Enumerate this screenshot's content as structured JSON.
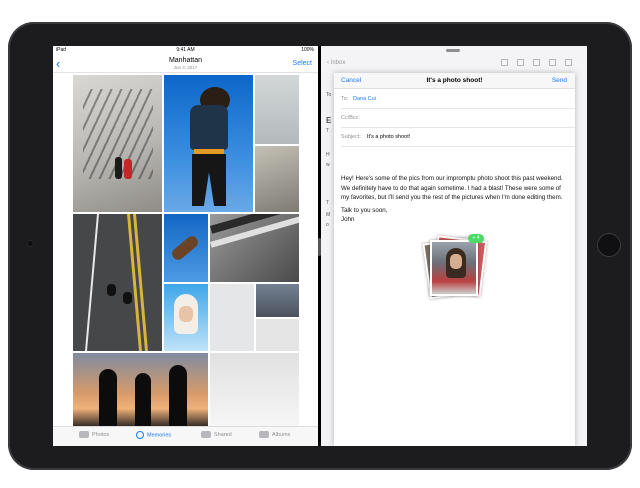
{
  "photos": {
    "status": {
      "left": "iPad",
      "time": "9:41 AM",
      "battery": "100%"
    },
    "nav": {
      "title": "Manhattan",
      "subtitle": "Jun 3, 2017",
      "select": "Select"
    },
    "tabs": [
      {
        "label": "Photos",
        "icon": "photos-icon",
        "active": false
      },
      {
        "label": "Memories",
        "icon": "memories-icon",
        "active": true
      },
      {
        "label": "Shared",
        "icon": "cloud-icon",
        "active": false
      },
      {
        "label": "Albums",
        "icon": "albums-icon",
        "active": false
      }
    ]
  },
  "mail": {
    "toolbar": {
      "inbox": "Inbox"
    },
    "side_letters": [
      "To",
      "E",
      "T",
      "H",
      "w",
      "T",
      "M",
      "o"
    ]
  },
  "compose": {
    "cancel": "Cancel",
    "title": "It's a photo shoot!",
    "send": "Send",
    "to_label": "To:",
    "to_value": "Dana Cui",
    "cc_label": "Cc/Bcc:",
    "subject_label": "Subject:",
    "subject_value": "It's a photo shoot!",
    "body": [
      "Hey! Here's some of the pics from our impromptu photo shoot this past weekend. We definitely have to do that again sometime. I had a blast! These were some of my favorites, but I'll send you the rest of the pictures when I'm done editing them.",
      "Talk to you soon,",
      "John"
    ],
    "drag_badge": "4"
  },
  "colors": {
    "accent": "#1a7cf2",
    "badge": "#4cd964"
  }
}
